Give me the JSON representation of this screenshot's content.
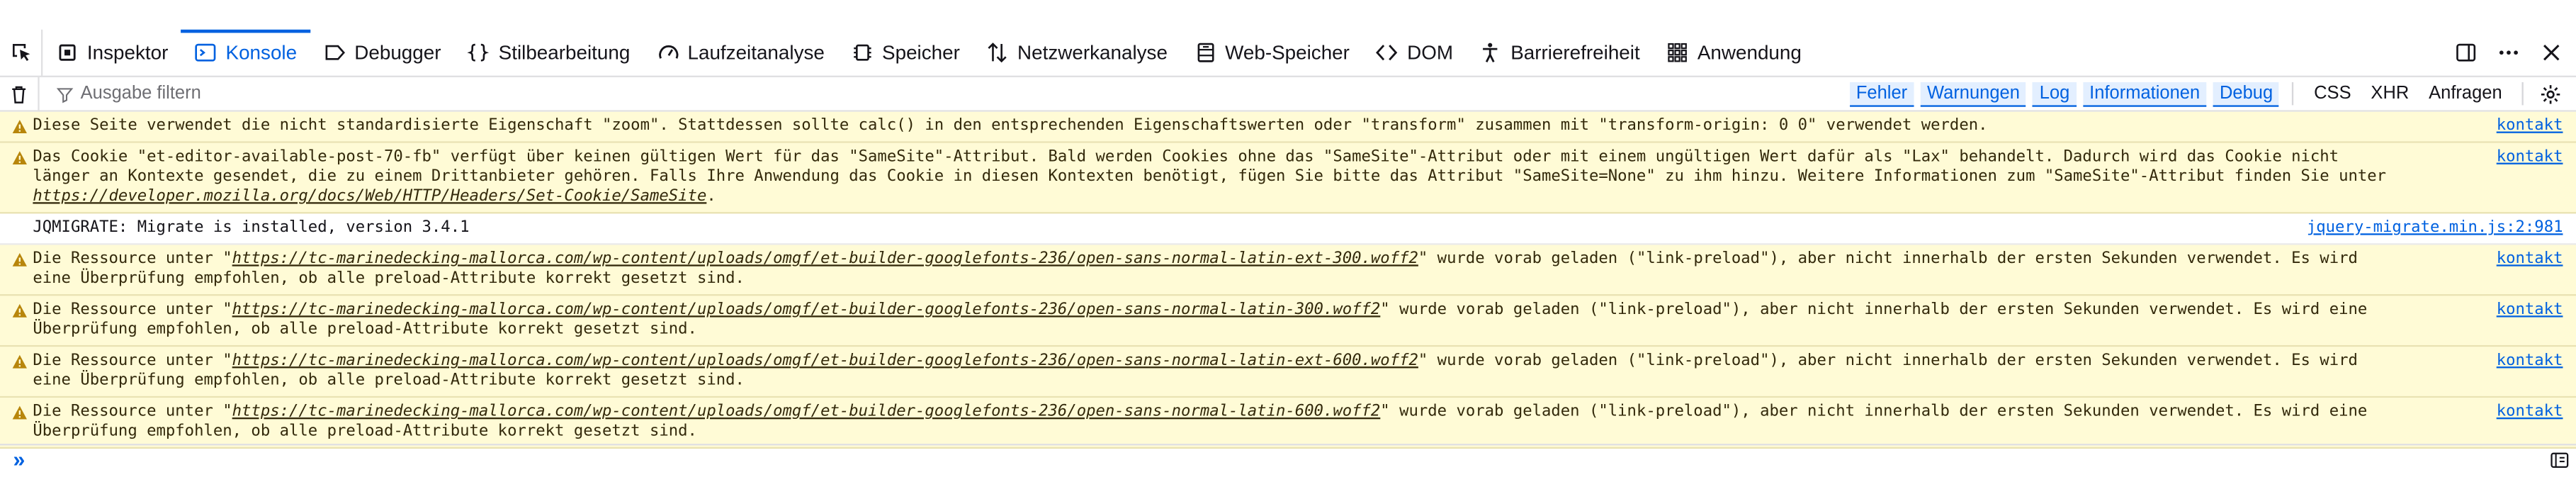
{
  "toolbar": {
    "tabs": [
      {
        "label": "Inspektor",
        "icon": "inspector-icon"
      },
      {
        "label": "Konsole",
        "icon": "console-icon"
      },
      {
        "label": "Debugger",
        "icon": "debugger-icon"
      },
      {
        "label": "Stilbearbeitung",
        "icon": "braces-icon"
      },
      {
        "label": "Laufzeitanalyse",
        "icon": "gauge-icon"
      },
      {
        "label": "Speicher",
        "icon": "memory-chip-icon"
      },
      {
        "label": "Netzwerkanalyse",
        "icon": "network-arrows-icon"
      },
      {
        "label": "Web-Speicher",
        "icon": "storage-icon"
      },
      {
        "label": "DOM",
        "icon": "code-brackets-icon"
      },
      {
        "label": "Barrierefreiheit",
        "icon": "accessibility-icon"
      },
      {
        "label": "Anwendung",
        "icon": "grid-icon"
      }
    ],
    "selected_tab": "Konsole"
  },
  "filter": {
    "placeholder": "Ausgabe filtern",
    "levels": [
      "Fehler",
      "Warnungen",
      "Log",
      "Informationen",
      "Debug"
    ],
    "extra": [
      "CSS",
      "XHR",
      "Anfragen"
    ]
  },
  "messages": [
    {
      "level": "warning",
      "text": "Diese Seite verwendet die nicht standardisierte Eigenschaft \"zoom\". Stattdessen sollte calc() in den entsprechenden Eigenschaftswerten oder \"transform\" zusammen mit \"transform-origin: 0 0\" verwendet werden.",
      "source": "kontakt"
    },
    {
      "level": "warning",
      "text": "Das Cookie \"et-editor-available-post-70-fb\" verfügt über keinen gültigen Wert für das \"SameSite\"-Attribut. Bald werden Cookies ohne das \"SameSite\"-Attribut oder mit einem ungültigen Wert dafür als \"Lax\" behandelt. Dadurch wird das Cookie nicht länger an Kontexte gesendet, die zu einem Drittanbieter gehören. Falls Ihre Anwendung das Cookie in diesen Kontexten benötigt, fügen Sie bitte das Attribut \"SameSite=None\" zu ihm hinzu. Weitere Informationen zum \"SameSite\"-Attribut finden Sie unter ",
      "link": "https://developer.mozilla.org/docs/Web/HTTP/Headers/Set-Cookie/SameSite",
      "after": ".",
      "source": "kontakt"
    },
    {
      "level": "log",
      "text": "JQMIGRATE: Migrate is installed, version 3.4.1",
      "source": "jquery-migrate.min.js:2:981"
    },
    {
      "level": "warning",
      "text": "Die Ressource unter \"",
      "link": "https://tc-marinedecking-mallorca.com/wp-content/uploads/omgf/et-builder-googlefonts-236/open-sans-normal-latin-ext-300.woff2",
      "after": "\" wurde vorab geladen (\"link-preload\"), aber nicht innerhalb der ersten Sekunden verwendet. Es wird eine Überprüfung empfohlen, ob alle preload-Attribute korrekt gesetzt sind.",
      "source": "kontakt"
    },
    {
      "level": "warning",
      "text": "Die Ressource unter \"",
      "link": "https://tc-marinedecking-mallorca.com/wp-content/uploads/omgf/et-builder-googlefonts-236/open-sans-normal-latin-300.woff2",
      "after": "\" wurde vorab geladen (\"link-preload\"), aber nicht innerhalb der ersten Sekunden verwendet. Es wird eine Überprüfung empfohlen, ob alle preload-Attribute korrekt gesetzt sind.",
      "source": "kontakt"
    },
    {
      "level": "warning",
      "text": "Die Ressource unter \"",
      "link": "https://tc-marinedecking-mallorca.com/wp-content/uploads/omgf/et-builder-googlefonts-236/open-sans-normal-latin-ext-600.woff2",
      "after": "\" wurde vorab geladen (\"link-preload\"), aber nicht innerhalb der ersten Sekunden verwendet. Es wird eine Überprüfung empfohlen, ob alle preload-Attribute korrekt gesetzt sind.",
      "source": "kontakt"
    },
    {
      "level": "warning",
      "text": "Die Ressource unter \"",
      "link": "https://tc-marinedecking-mallorca.com/wp-content/uploads/omgf/et-builder-googlefonts-236/open-sans-normal-latin-600.woff2",
      "after": "\" wurde vorab geladen (\"link-preload\"), aber nicht innerhalb der ersten Sekunden verwendet. Es wird eine Überprüfung empfohlen, ob alle preload-Attribute korrekt gesetzt sind.",
      "source": "kontakt"
    }
  ],
  "prompt": {
    "chevron": "»"
  },
  "colors": {
    "accent": "#0061e0",
    "warning_bg": "#fffbd6",
    "warning_icon": "#b8860b"
  }
}
